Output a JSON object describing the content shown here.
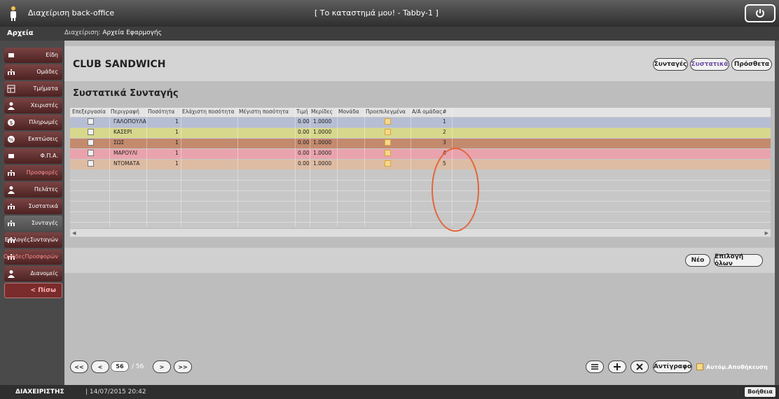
{
  "topbar": {
    "app_title": "Διαχείριση back-office",
    "store_title": "[ Το καταστημά μου! - Tabby-1 ]",
    "logo_icon": "tabby-logo-icon",
    "power_icon": "power-icon"
  },
  "subbar": {
    "section_title": "Αρχεία",
    "breadcrumb_prefix": "Διαχείριση:",
    "breadcrumb_current": "Αρχεία Εφαρμογής"
  },
  "sidebar": {
    "items": [
      {
        "label": "Είδη",
        "icon": "square-icon"
      },
      {
        "label": "Ομάδες",
        "icon": "group-icon"
      },
      {
        "label": "Τμήματα",
        "icon": "department-icon"
      },
      {
        "label": "Χειριστές",
        "icon": "user-icon"
      },
      {
        "label": "Πληρωμές",
        "icon": "payment-icon"
      },
      {
        "label": "Εκπτώσεις",
        "icon": "discount-icon"
      },
      {
        "label": "Φ.Π.Α.",
        "icon": "square-icon"
      },
      {
        "label": "Προσφορές",
        "icon": "group-icon"
      },
      {
        "label": "Πελάτες",
        "icon": "user-icon"
      },
      {
        "label": "Συστατικά",
        "icon": "group-icon"
      },
      {
        "label": "Συνταγές",
        "icon": "group-icon"
      },
      {
        "label_line1": "Επιλογές",
        "label_line2": "Συνταγών",
        "icon": "group-icon"
      },
      {
        "label_line1": "Ομάδες",
        "label_line2": "Προσφορών",
        "icon": "group-icon"
      },
      {
        "label": "Διανομείς",
        "icon": "user-icon"
      }
    ],
    "back_label": "< Πίσω"
  },
  "main": {
    "recipe_title": "CLUB SANDWICH",
    "tabs": [
      {
        "label": "Συνταγές",
        "active": false
      },
      {
        "label": "Συστατικά",
        "active": true
      },
      {
        "label": "Πρόσθετα",
        "active": false
      }
    ],
    "section_title": "Συστατικά Συνταγής"
  },
  "grid": {
    "columns": [
      "Επεξεργασία",
      "Περιγραφή",
      "Ποσότητα",
      "Ελάχιστη ποσότητα",
      "Μέγιστη ποσότητα",
      "Τιμή",
      "Μερίδες",
      "Μονάδα",
      "Προεπιλεγμένα",
      "Α/Α ομάδας#"
    ],
    "rows": [
      {
        "description": "ΓΑΛΟΠΟΥΛΑ",
        "quantity": "1",
        "price": "0.00",
        "portions": "1.0000",
        "group_no": "1",
        "color": "#b6bed3"
      },
      {
        "description": "ΚΑΣΕΡΙ",
        "quantity": "1",
        "price": "0.00",
        "portions": "1.0000",
        "group_no": "2",
        "color": "#d8d88c"
      },
      {
        "description": "ΣΩΣ",
        "quantity": "1",
        "price": "0.00",
        "portions": "1.0000",
        "group_no": "3",
        "color": "#c48a6e"
      },
      {
        "description": "ΜΑΡΟΥΛΙ",
        "quantity": "1",
        "price": "0.00",
        "portions": "1.0000",
        "group_no": "4",
        "color": "#e9a3ad"
      },
      {
        "description": "ΝΤΟΜΑΤΑ",
        "quantity": "1",
        "price": "0.00",
        "portions": "1.0000",
        "group_no": "5",
        "color": "#ddbca3"
      }
    ]
  },
  "actions": {
    "new_label": "Νέο",
    "select_all_label": "Επιλογή όλων"
  },
  "pager": {
    "first": "<<",
    "prev": "<",
    "current": "56",
    "total": "/ 56",
    "next": ">",
    "last": ">>"
  },
  "toolbar": {
    "copy_label": "Αντίγραφο",
    "autosave_label": "Αυτόμ.Αποθήκευση",
    "list_icon": "list-icon",
    "add_icon": "plus-icon",
    "delete_icon": "close-icon"
  },
  "status": {
    "user": "ΔΙΑΧΕΙΡΙΣΤΗΣ",
    "date": "| 14/07/2015 20:42",
    "help_label": "Βοήθεια"
  },
  "colors": {
    "accent_active_tab": "#6a4ca0",
    "highlight_ring": "#e0663b",
    "sidebar_item": "#6a3535",
    "default_checkbox": "#f5d98a"
  }
}
